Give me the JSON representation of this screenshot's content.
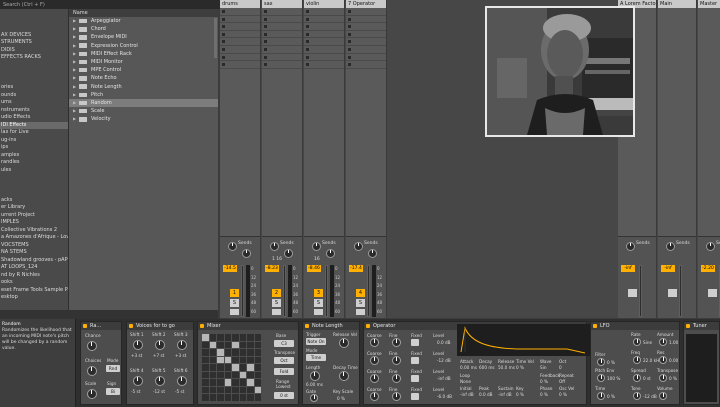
{
  "browser": {
    "topbar": "Search (Ctrl + F)",
    "categories": [
      {
        "label": "",
        "sel": false
      },
      {
        "label": "",
        "sel": false
      },
      {
        "label": "",
        "sel": false
      },
      {
        "label": "AX DEVICES",
        "sel": false
      },
      {
        "label": "STRUMENTS",
        "sel": false
      },
      {
        "label": "DIDIS",
        "sel": false
      },
      {
        "label": "EFFECTS RACKS",
        "sel": false
      },
      {
        "label": "",
        "sel": false
      },
      {
        "label": "",
        "sel": false
      },
      {
        "label": "",
        "sel": false
      },
      {
        "label": "ories",
        "sel": false
      },
      {
        "label": "ounds",
        "sel": false
      },
      {
        "label": "ums",
        "sel": false
      },
      {
        "label": "nstruments",
        "sel": false
      },
      {
        "label": "udio Effects",
        "sel": false
      },
      {
        "label": "IDI Effects",
        "sel": true
      },
      {
        "label": "lax for Live",
        "sel": false
      },
      {
        "label": "ug-ins",
        "sel": false
      },
      {
        "label": "ips",
        "sel": false
      },
      {
        "label": "amples",
        "sel": false
      },
      {
        "label": "randles",
        "sel": false
      },
      {
        "label": "ules",
        "sel": false
      },
      {
        "label": "",
        "sel": false
      },
      {
        "label": "",
        "sel": false
      },
      {
        "label": "",
        "sel": false
      },
      {
        "label": "acks",
        "sel": false
      },
      {
        "label": "er Library",
        "sel": false
      },
      {
        "label": "urrent Project",
        "sel": false
      },
      {
        "label": "IMPLES",
        "sel": false
      },
      {
        "label": "Collective Vibrations 2",
        "sel": false
      },
      {
        "label": "a Amazones d'Afrique - Love N",
        "sel": false
      },
      {
        "label": "VOCSTEMS",
        "sel": false
      },
      {
        "label": "NA STEMS",
        "sel": false
      },
      {
        "label": "Shadowland grooves - pAPONIS",
        "sel": false
      },
      {
        "label": "AT LOOPS_124",
        "sel": false
      },
      {
        "label": "nd by R Nichles",
        "sel": false
      },
      {
        "label": "ooks",
        "sel": false
      },
      {
        "label": "eset Frame Tools Sample Pack I",
        "sel": false
      },
      {
        "label": "esktop",
        "sel": false
      }
    ],
    "list_header": "Name",
    "items": [
      {
        "label": "Arpeggiator",
        "sel": false
      },
      {
        "label": "Chord",
        "sel": false
      },
      {
        "label": "Envelope MIDI",
        "sel": false
      },
      {
        "label": "Expression Control",
        "sel": false
      },
      {
        "label": "MIDI Effect Rack",
        "sel": false
      },
      {
        "label": "MIDI Monitor",
        "sel": false
      },
      {
        "label": "MPE Control",
        "sel": false
      },
      {
        "label": "Note Echo",
        "sel": false
      },
      {
        "label": "Note Length",
        "sel": false
      },
      {
        "label": "Pitch",
        "sel": false
      },
      {
        "label": "Random",
        "sel": true
      },
      {
        "label": "Scale",
        "sel": false
      },
      {
        "label": "Velocity",
        "sel": false
      }
    ]
  },
  "session": {
    "tracks": [
      {
        "name": "drums",
        "vol": "-14.5",
        "num": "1",
        "send_label": "Sends",
        "num_label": ""
      },
      {
        "name": "sax",
        "vol": "-8.23",
        "num": "2",
        "send_label": "Sends",
        "num_label": "1   16"
      },
      {
        "name": "violin",
        "vol": "-8.46",
        "num": "3",
        "send_label": "Sends",
        "num_label": "16"
      },
      {
        "name": "7 Operator",
        "vol": "-17.4",
        "num": "4",
        "send_label": "Sends",
        "num_label": ""
      }
    ],
    "right_tracks": [
      {
        "name": "A Lorem Factory",
        "vol": "-inf"
      },
      {
        "name": "Main",
        "vol": "-inf"
      },
      {
        "name": "Master",
        "vol": "-2.20"
      }
    ],
    "scale": [
      "0",
      "12",
      "24",
      "36",
      "48",
      "60"
    ],
    "returns": [
      "Sends",
      "Sends"
    ]
  },
  "info": {
    "title": "Random",
    "text": "Randomizes the likelihood that an incoming MIDI note's pitch will be changed by a random value."
  },
  "devices": {
    "random": {
      "title": "Ra...",
      "labels": [
        "Chance",
        "Choices",
        "Scale",
        "Mode",
        "Rnd",
        "Sign",
        "Bi"
      ]
    },
    "pitch": {
      "title": "Voices for to go",
      "labels": [
        "Shift 1",
        "Shift 2",
        "Shift 3",
        "Shift 4",
        "Shift 5",
        "Shift 6"
      ],
      "values": [
        "+3 st",
        "+7 st",
        "+3 st",
        "-5 st",
        "-12 st",
        "-5 st"
      ]
    },
    "mixer": {
      "title": "Mixer",
      "labels": [
        "Base",
        "Transpose",
        "Fold",
        "Range",
        "Lowest"
      ],
      "values": [
        "C3",
        "Oct",
        "0 st"
      ]
    },
    "notelen": {
      "title": "Note Length",
      "labels": [
        "Trigger",
        "Release Vel",
        "Mode",
        "Length",
        "Decay Time",
        "Gate",
        "Key Scale"
      ],
      "values": [
        "Note On",
        "Time",
        "6.00 ms",
        "0 %"
      ]
    },
    "operator": {
      "title": "Operator",
      "labels": [
        "Coarse",
        "Fine",
        "Fixed",
        "Level"
      ],
      "values": [
        "0.0 dB",
        "-12 dB",
        "-inf dB",
        "-6.0 dB"
      ],
      "envelope": [
        "Attack",
        "Decay",
        "Release",
        "Time Vel",
        "Wave",
        "Feedback",
        "Repeat",
        "Loop",
        "Phase",
        "Osc Vel",
        "Initial",
        "Peak",
        "Sustain",
        "Key",
        "Oct"
      ],
      "env_values": [
        "0.00 ms",
        "600 ms",
        "50.0 ms",
        "0 %",
        "Sin",
        "0 %",
        "Off",
        "None",
        "0 %",
        "0 %",
        "-inf dB",
        "0.0 dB",
        "-inf dB",
        "0 %",
        "0"
      ]
    },
    "lfo": {
      "title": "LFO",
      "labels": [
        "Rate",
        "Amount",
        "Freq",
        "Res",
        "Filter",
        "Spread",
        "Transpose",
        "Pitch Env",
        "Time",
        "Tone",
        "Volume"
      ],
      "values": [
        "Sine",
        "1.00",
        "22.0 kHz",
        "0.00",
        "0 %",
        "0 st",
        "0 %",
        "100 %",
        "0 %",
        "-12 dB"
      ]
    },
    "tuner": {
      "title": "Tuner"
    }
  }
}
